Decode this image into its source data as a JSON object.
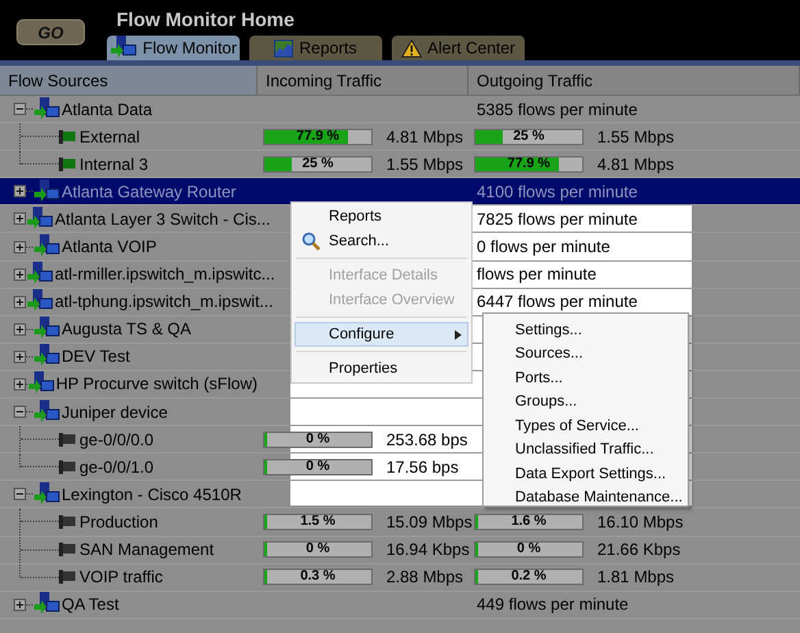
{
  "title": "Flow Monitor Home",
  "go_button": "GO",
  "tabs": [
    {
      "label": "Flow Monitor",
      "selected": true,
      "kind": "monitor"
    },
    {
      "label": "Reports",
      "selected": false,
      "kind": "chart"
    },
    {
      "label": "Alert Center",
      "selected": false,
      "kind": "alert"
    }
  ],
  "columns": [
    "Flow Sources",
    "Incoming Traffic",
    "Outgoing Traffic"
  ],
  "sources": [
    {
      "name": "Atlanta Data",
      "expanded": true,
      "selected": false,
      "outgoing": "5385 flows per minute",
      "children": [
        {
          "name": "External",
          "kind": "active",
          "incoming": {
            "level": 0.779,
            "label": "77.9 %",
            "rate": "4.81 Mbps"
          },
          "outgoing": {
            "level": 0.25,
            "label": "25 %",
            "rate": "1.55 Mbps"
          }
        },
        {
          "name": "Internal 3",
          "kind": "active",
          "incoming": {
            "level": 0.25,
            "label": "25 %",
            "rate": "1.55 Mbps"
          },
          "outgoing": {
            "level": 0.779,
            "label": "77.9 %",
            "rate": "4.81 Mbps"
          }
        }
      ]
    },
    {
      "name": "Atlanta Gateway Router",
      "expanded": false,
      "selected": true,
      "outgoing": "4100 flows per minute"
    },
    {
      "name": "Atlanta Layer 3 Switch - Cis...",
      "expanded": false,
      "selected": false,
      "outgoing": "7825 flows per minute"
    },
    {
      "name": "Atlanta VOIP",
      "expanded": false,
      "selected": false,
      "outgoing": "0 flows per minute"
    },
    {
      "name": "atl-rmiller.ipswitch_m.ipswitc...",
      "expanded": false,
      "selected": false,
      "outgoing": "flows per minute"
    },
    {
      "name": "atl-tphung.ipswitch_m.ipswit...",
      "expanded": false,
      "selected": false,
      "outgoing": "6447 flows per minute"
    },
    {
      "name": "Augusta TS & QA",
      "expanded": false,
      "selected": false
    },
    {
      "name": "DEV Test",
      "expanded": false,
      "selected": false
    },
    {
      "name": "HP Procurve switch (sFlow)",
      "expanded": false,
      "selected": false
    },
    {
      "name": "Juniper device",
      "expanded": true,
      "selected": false,
      "children": [
        {
          "name": "ge-0/0/0.0",
          "kind": "plain",
          "incoming": {
            "level": 0,
            "label": "0 %",
            "rate": "253.68 bps"
          }
        },
        {
          "name": "ge-0/0/1.0",
          "kind": "plain",
          "incoming": {
            "level": 0,
            "label": "0 %",
            "rate": "17.56 bps"
          }
        }
      ]
    },
    {
      "name": "Lexington - Cisco 4510R",
      "expanded": true,
      "selected": false,
      "children": [
        {
          "name": "Production",
          "kind": "plain",
          "incoming": {
            "level": 0.015,
            "label": "1.5 %",
            "rate": "15.09 Mbps"
          },
          "outgoing": {
            "level": 0.016,
            "label": "1.6 %",
            "rate": "16.10 Mbps"
          }
        },
        {
          "name": "SAN Management",
          "kind": "plain",
          "incoming": {
            "level": 0,
            "label": "0 %",
            "rate": "16.94 Kbps"
          },
          "outgoing": {
            "level": 0,
            "label": "0 %",
            "rate": "21.66 Kbps"
          }
        },
        {
          "name": "VOIP traffic",
          "kind": "plain",
          "incoming": {
            "level": 0.003,
            "label": "0.3 %",
            "rate": "2.88 Mbps"
          },
          "outgoing": {
            "level": 0.002,
            "label": "0.2 %",
            "rate": "1.81 Mbps"
          }
        }
      ]
    },
    {
      "name": "QA Test",
      "expanded": false,
      "selected": false,
      "outgoing": "449 flows per minute"
    }
  ],
  "context_menu": [
    {
      "kind": "item",
      "label": "Reports",
      "disabled": false,
      "selected": false
    },
    {
      "kind": "search",
      "label": "Search...",
      "disabled": false,
      "selected": false
    },
    {
      "kind": "separator"
    },
    {
      "kind": "item",
      "label": "Interface Details",
      "disabled": true,
      "selected": false
    },
    {
      "kind": "item",
      "label": "Interface Overview",
      "disabled": true,
      "selected": false
    },
    {
      "kind": "separator"
    },
    {
      "kind": "item",
      "label": "Configure",
      "disabled": false,
      "selected": true,
      "submenu": true
    },
    {
      "kind": "separator"
    },
    {
      "kind": "item",
      "label": "Properties",
      "disabled": false,
      "selected": false
    }
  ],
  "submenu": [
    "Settings...",
    "Sources...",
    "Ports...",
    "Groups...",
    "Types of Service...",
    "Unclassified Traffic...",
    "Data Export Settings...",
    "Database Maintenance..."
  ]
}
